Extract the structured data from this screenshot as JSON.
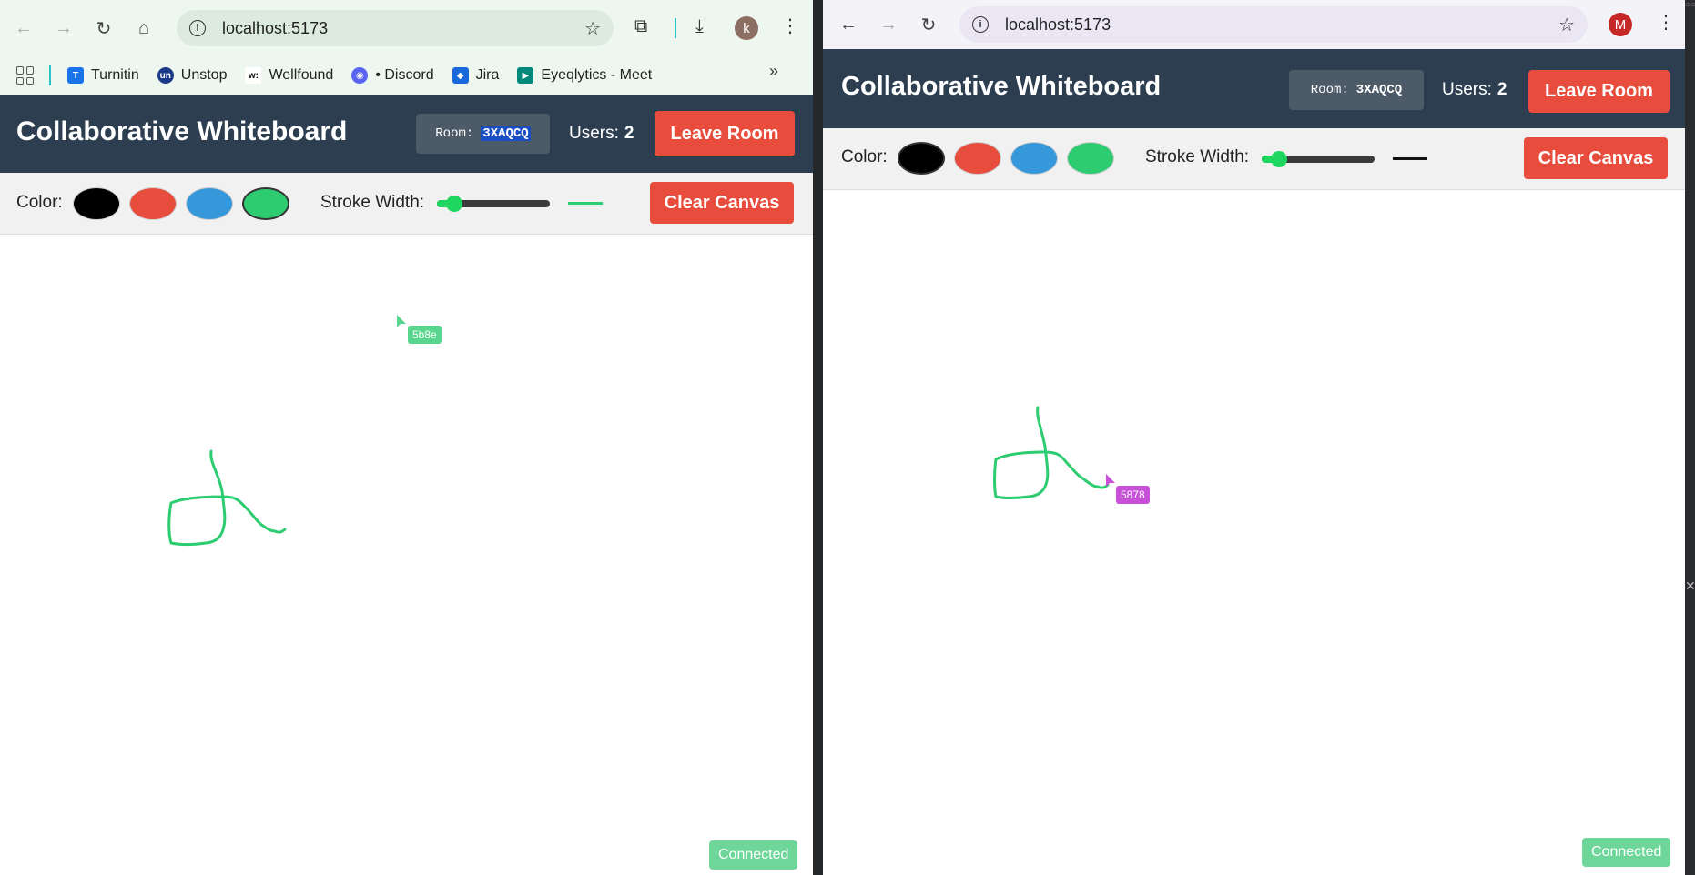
{
  "left_window": {
    "browser": {
      "url": "localhost:5173",
      "avatar_letter": "k",
      "bookmarks": [
        {
          "label": "Turnitin",
          "icon": "turnitin-icon",
          "color": "#1a73e8"
        },
        {
          "label": "Unstop",
          "icon": "unstop-icon",
          "color": "#1b3a8a"
        },
        {
          "label": "Wellfound",
          "icon": "wellfound-icon",
          "color": "#111111"
        },
        {
          "label": "• Discord",
          "icon": "discord-icon",
          "color": "#5865f2"
        },
        {
          "label": "Jira",
          "icon": "jira-icon",
          "color": "#1868db"
        },
        {
          "label": "Eyeqlytics - Meet",
          "icon": "meet-icon",
          "color": "#00897b"
        }
      ],
      "more_bookmarks": "»"
    },
    "app": {
      "title": "Collaborative Whiteboard",
      "room_label": "Room:",
      "room_code": "3XAQCQ",
      "users_label": "Users:",
      "users_count": "2",
      "leave_label": "Leave Room",
      "color_label": "Color:",
      "colors": [
        "#000000",
        "#e74c3c",
        "#3498db",
        "#2ecc71"
      ],
      "selected_color": "#2ecc71",
      "stroke_label": "Stroke Width:",
      "stroke_level": 0.15,
      "clear_label": "Clear Canvas",
      "remote_cursor_id": "5b8e",
      "remote_cursor_color": "#58d68d",
      "status": "Connected"
    }
  },
  "right_window": {
    "browser": {
      "url": "localhost:5173",
      "avatar_letter": "M"
    },
    "app": {
      "title": "Collaborative Whiteboard",
      "room_label": "Room:",
      "room_code": "3XAQCQ",
      "users_label": "Users:",
      "users_count": "2",
      "leave_label": "Leave Room",
      "color_label": "Color:",
      "colors": [
        "#000000",
        "#e74c3c",
        "#3498db",
        "#2ecc71"
      ],
      "selected_color": "#000000",
      "stroke_label": "Stroke Width:",
      "stroke_level": 0.15,
      "clear_label": "Clear Canvas",
      "remote_cursor_id": "5878",
      "remote_cursor_color": "#c850d8",
      "status": "Connected"
    }
  }
}
